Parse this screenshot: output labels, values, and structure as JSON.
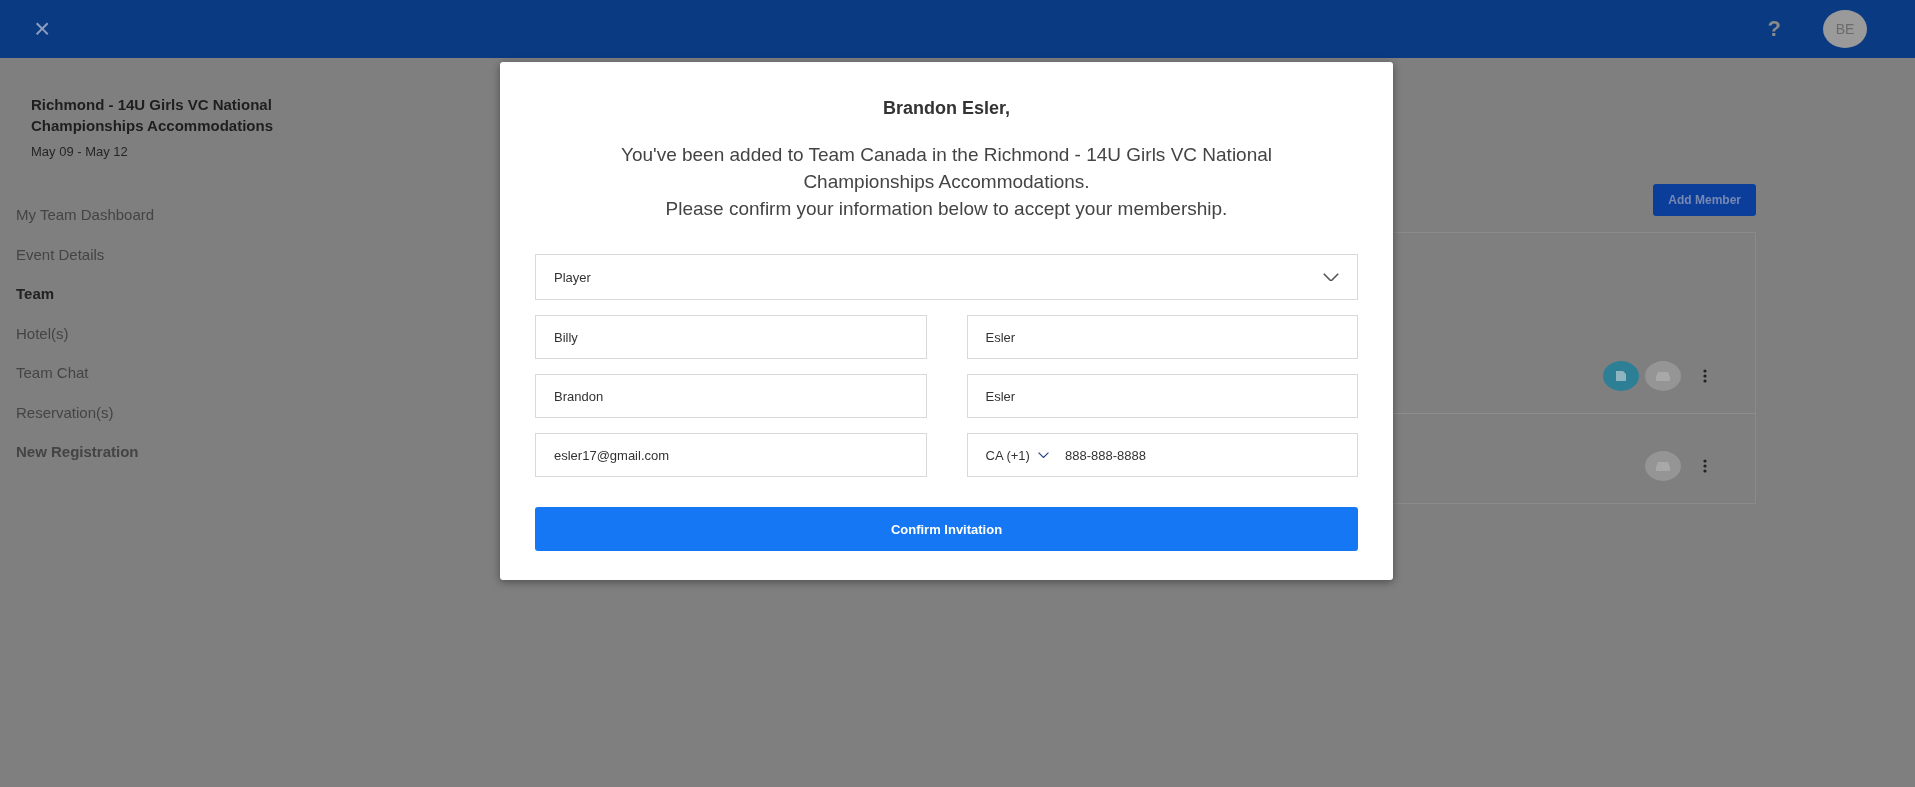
{
  "header": {
    "close": "×",
    "help": "?",
    "avatar": "BE"
  },
  "event": {
    "title": "Richmond - 14U Girls VC National Championships Accommodations",
    "dates": "May 09 - May 12"
  },
  "sidebar": {
    "items": [
      {
        "label": "My Team Dashboard",
        "selected": false,
        "kind": "link"
      },
      {
        "label": "Event Details",
        "selected": false,
        "kind": "link"
      },
      {
        "label": "Team",
        "selected": true,
        "kind": "link"
      },
      {
        "label": "Hotel(s)",
        "selected": false,
        "kind": "link"
      },
      {
        "label": "Team Chat",
        "selected": false,
        "kind": "link"
      },
      {
        "label": "Reservation(s)",
        "selected": false,
        "kind": "link"
      },
      {
        "label": "New Registration",
        "selected": false,
        "kind": "action"
      }
    ]
  },
  "add_member": "Add Member",
  "members": [
    {
      "actions": [
        {
          "kind": "document"
        },
        {
          "kind": "car"
        }
      ]
    },
    {
      "actions": [
        {
          "kind": "car"
        }
      ]
    }
  ],
  "dialog": {
    "greeting": "Brandon Esler,",
    "message": [
      "You've been added to Team Canada in the Richmond - 14U Girls VC National Championships Accommodations.",
      "Please confirm your information below to accept your membership."
    ],
    "role": "Player",
    "rows": [
      [
        "Billy",
        "Esler"
      ],
      [
        "Brandon",
        "Esler"
      ]
    ],
    "email": "esler17@gmail.com",
    "country_code": "CA (+1)",
    "phone": "888-888-8888",
    "confirm": "Confirm Invitation"
  }
}
